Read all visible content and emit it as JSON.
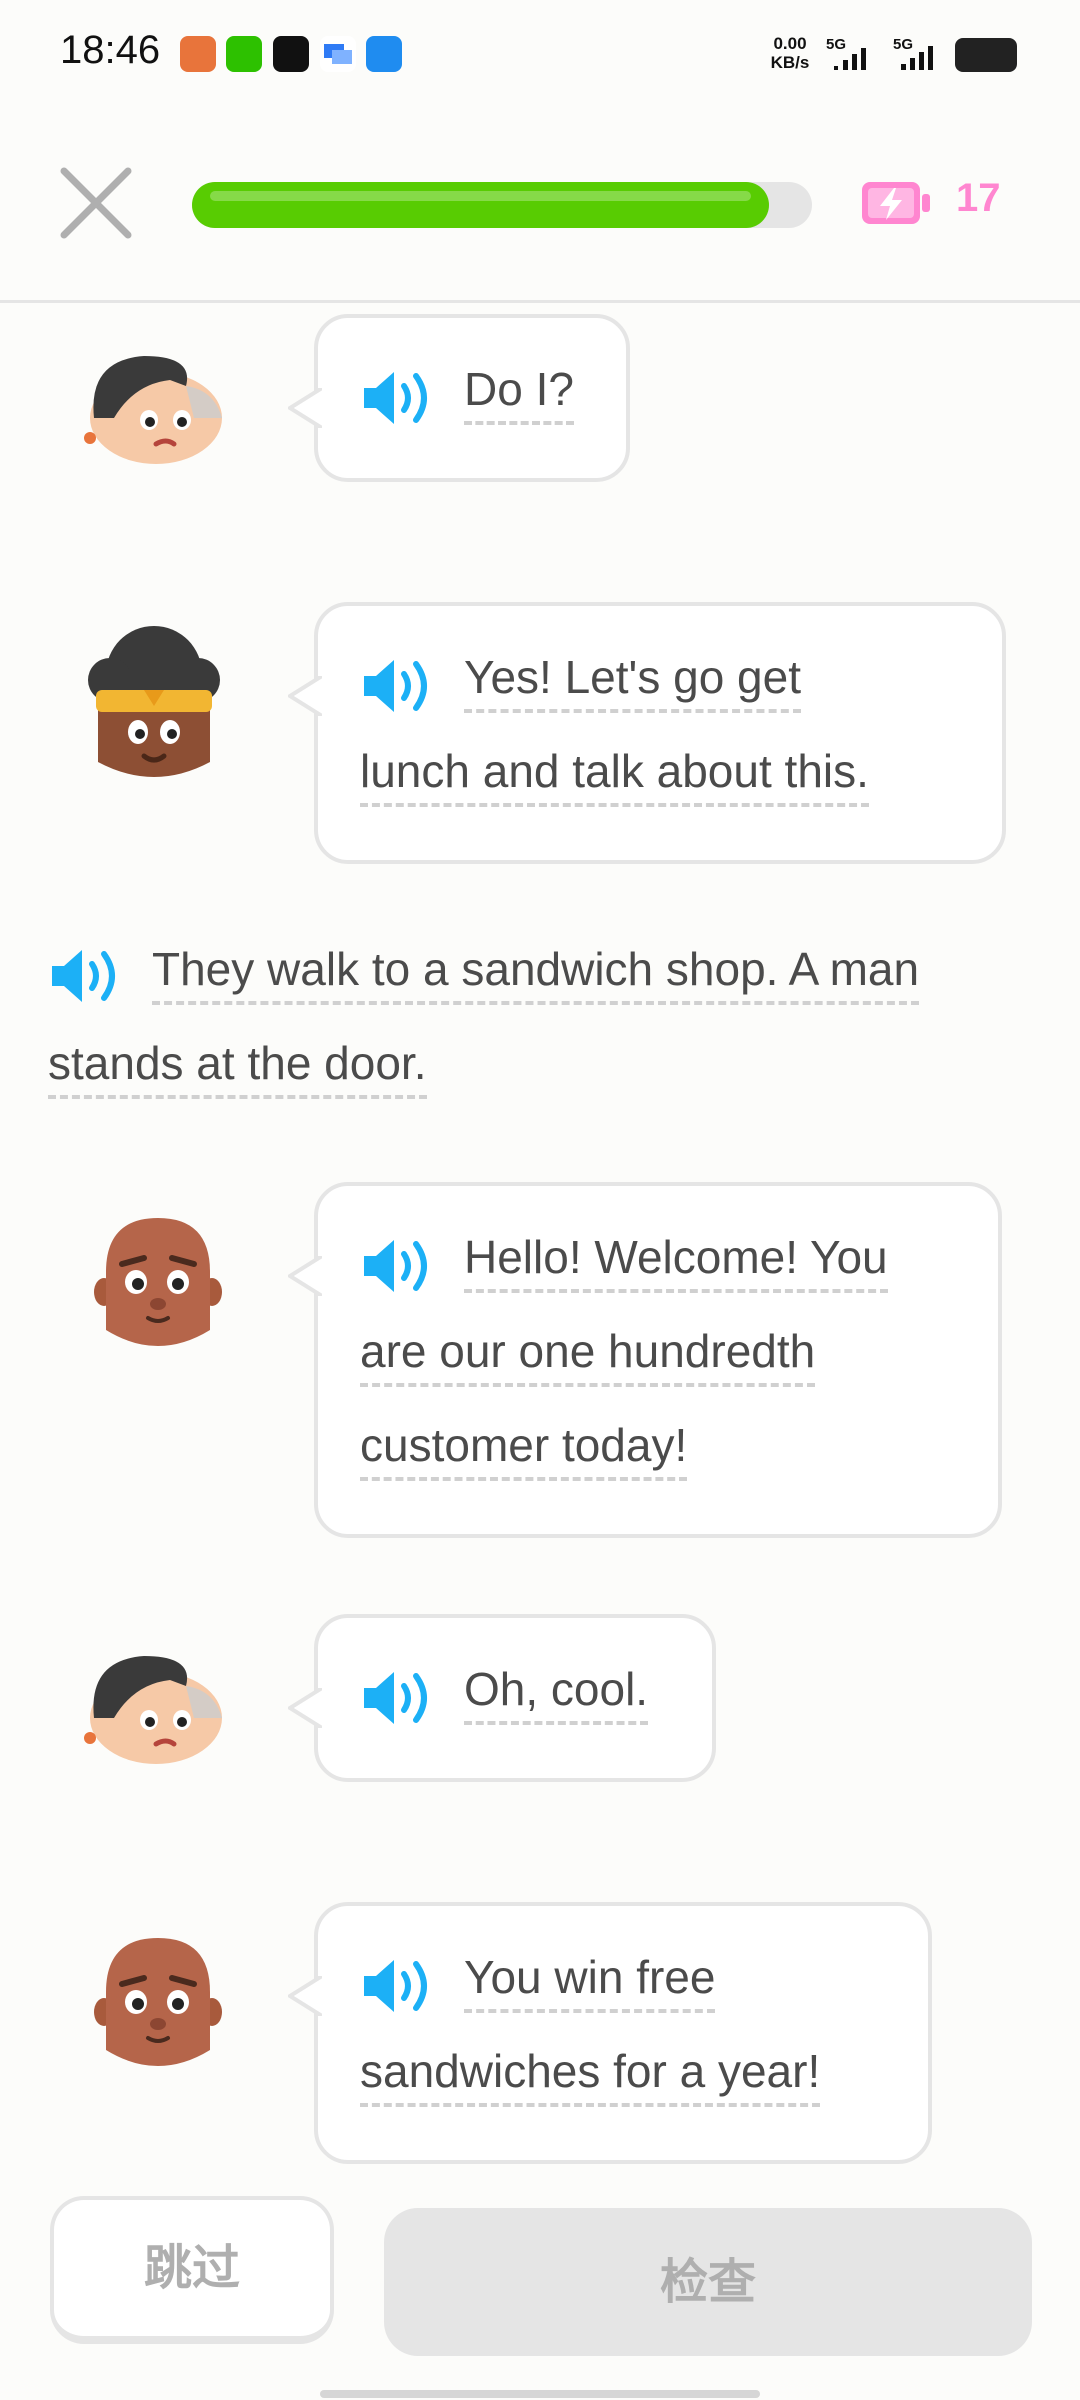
{
  "status_bar": {
    "time": "18:46",
    "net_speed_value": "0.00",
    "net_speed_unit": "KB/s",
    "signal1": "5G",
    "signal2": "5G",
    "apps": [
      "cat-app-icon",
      "wechat-icon",
      "tiktok-icon",
      "chat-app-icon",
      "browser-icon"
    ]
  },
  "header": {
    "progress_fraction": 0.93,
    "energy_count": "17",
    "energy_color": "#ff86d0",
    "progress_color": "#58cc02"
  },
  "conversation": [
    {
      "speaker": "woman-gray-hair",
      "lines": [
        [
          {
            "t": "Do I?",
            "u": true
          }
        ]
      ]
    },
    {
      "speaker": "woman-bun-headband",
      "lines": [
        [
          {
            "t": "Yes! Let's go get",
            "u": true
          }
        ],
        [
          {
            "t": "lunch and talk about this.",
            "u": true
          }
        ]
      ]
    },
    {
      "speaker": "narrator",
      "lines": [
        [
          {
            "t": "They walk to a sandwich shop. A man",
            "u": true
          }
        ],
        [
          {
            "t": "stands at the door.",
            "u": true
          }
        ]
      ]
    },
    {
      "speaker": "bald-man",
      "lines": [
        [
          {
            "t": "Hello! Welcome! You",
            "u": true
          }
        ],
        [
          {
            "t": "are our one hundredth",
            "u": true
          }
        ],
        [
          {
            "t": "customer today!",
            "u": true
          }
        ]
      ]
    },
    {
      "speaker": "woman-gray-hair",
      "lines": [
        [
          {
            "t": "Oh, cool.",
            "u": true
          }
        ]
      ]
    },
    {
      "speaker": "bald-man",
      "lines": [
        [
          {
            "t": "You win free",
            "u": true
          }
        ],
        [
          {
            "t": "sandwiches for a year!",
            "u": true
          }
        ]
      ]
    }
  ],
  "footer": {
    "skip_label": "跳过",
    "check_label": "检查"
  }
}
